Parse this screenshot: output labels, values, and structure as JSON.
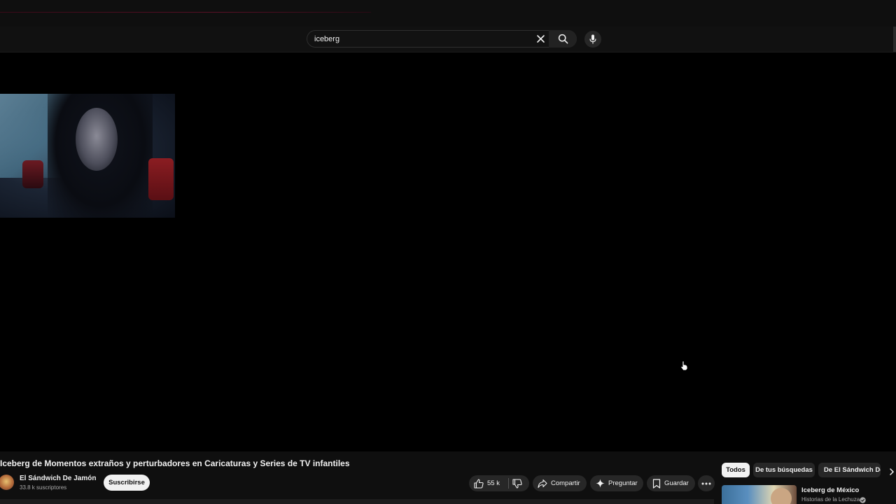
{
  "search": {
    "value": "iceberg"
  },
  "video": {
    "title": "Iceberg de Momentos extraños y perturbadores en Caricaturas y Series de TV infantiles",
    "channel_name": "El Sándwich De Jamón",
    "subscribers": "33.8 k suscriptores"
  },
  "actions": {
    "subscribe": "Suscribirse",
    "likes": "55 k",
    "share": "Compartir",
    "ask": "Preguntar",
    "save": "Guardar"
  },
  "filter_chips": [
    {
      "label": "Todos",
      "selected": true
    },
    {
      "label": "De tus búsquedas",
      "selected": false
    },
    {
      "label": "De El Sándwich De Jamón",
      "selected": false
    }
  ],
  "recommendation": {
    "title": "Iceberg de México",
    "channel": "Historias de la Lechuza"
  },
  "colors": {
    "background": "#000000",
    "surface": "#0f0f0f",
    "chip_active": "#f1f1f1",
    "chip_idle": "#272727"
  },
  "icons": [
    "clear-icon",
    "search-icon",
    "mic-icon",
    "like-icon",
    "dislike-icon",
    "share-icon",
    "sparkle-icon",
    "bookmark-icon",
    "more-icon",
    "chevron-right-icon",
    "verified-icon",
    "cursor-icon"
  ]
}
